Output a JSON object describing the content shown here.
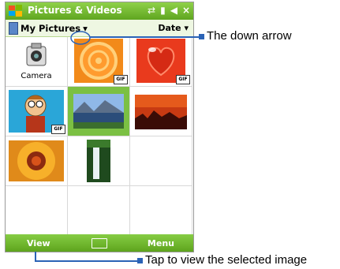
{
  "app": {
    "title": "Pictures & Videos",
    "status_icons": [
      "signal-icon",
      "volume-icon",
      "close-icon"
    ],
    "close_label": "×"
  },
  "toolbar": {
    "folder_label": "My Pictures",
    "sort_label": "Date"
  },
  "grid": {
    "camera_label": "Camera",
    "gif_badge": "GIF"
  },
  "softkeys": {
    "left": "View",
    "right": "Menu"
  },
  "callouts": {
    "down_arrow": "The down arrow",
    "tap_view": "Tap to view the selected image"
  },
  "colors": {
    "titlebar": "#6fb52f",
    "selection": "#7bc043",
    "callout": "#2b63b6"
  }
}
